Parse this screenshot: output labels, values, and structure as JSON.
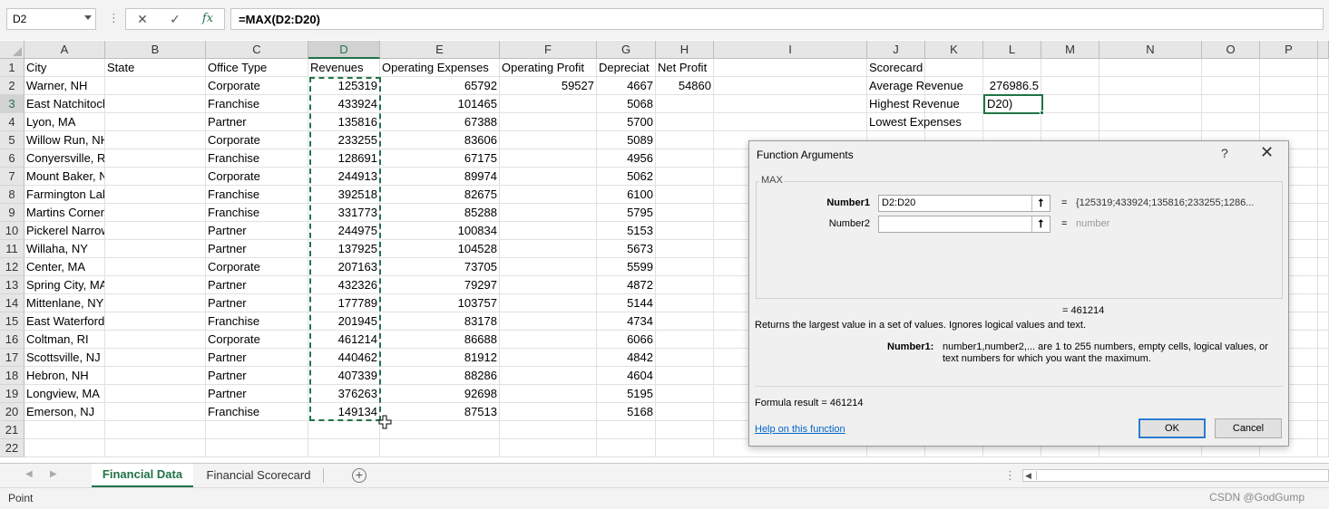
{
  "formula_bar": {
    "name_box": "D2",
    "cancel_glyph": "✕",
    "enter_glyph": "✓",
    "fx_label": "fx",
    "formula": "=MAX(D2:D20)"
  },
  "columns": [
    "A",
    "B",
    "C",
    "D",
    "E",
    "F",
    "G",
    "H",
    "I",
    "J",
    "K",
    "L",
    "M",
    "N",
    "O",
    "P"
  ],
  "active_column": "D",
  "active_row": 3,
  "row_numbers": [
    1,
    2,
    3,
    4,
    5,
    6,
    7,
    8,
    9,
    10,
    11,
    12,
    13,
    14,
    15,
    16,
    17,
    18,
    19,
    20,
    21,
    22
  ],
  "headers": {
    "city": "City",
    "state": "State",
    "office_type": "Office Type",
    "revenues": "Revenues",
    "operating_expenses": "Operating Expenses",
    "operating_profit": "Operating Profit",
    "depreciation": "Depreciat",
    "net_profit": "Net Profit"
  },
  "rows": [
    {
      "city": "Warner, NH",
      "state": "",
      "office_type": "Corporate",
      "revenues": "125319",
      "operating_expenses": "65792",
      "operating_profit": "59527",
      "depreciation": "4667",
      "net_profit": "54860"
    },
    {
      "city": "East Natchitoches, RI",
      "state": "",
      "office_type": "Franchise",
      "revenues": "433924",
      "operating_expenses": "101465",
      "operating_profit": "",
      "depreciation": "5068",
      "net_profit": ""
    },
    {
      "city": "Lyon, MA",
      "state": "",
      "office_type": "Partner",
      "revenues": "135816",
      "operating_expenses": "67388",
      "operating_profit": "",
      "depreciation": "5700",
      "net_profit": ""
    },
    {
      "city": "Willow Run, NH",
      "state": "",
      "office_type": "Corporate",
      "revenues": "233255",
      "operating_expenses": "83606",
      "operating_profit": "",
      "depreciation": "5089",
      "net_profit": ""
    },
    {
      "city": "Conyersville, RI",
      "state": "",
      "office_type": "Franchise",
      "revenues": "128691",
      "operating_expenses": "67175",
      "operating_profit": "",
      "depreciation": "4956",
      "net_profit": ""
    },
    {
      "city": "Mount Baker, NY",
      "state": "",
      "office_type": "Corporate",
      "revenues": "244913",
      "operating_expenses": "89974",
      "operating_profit": "",
      "depreciation": "5062",
      "net_profit": ""
    },
    {
      "city": "Farmington Lake, RI",
      "state": "",
      "office_type": "Franchise",
      "revenues": "392518",
      "operating_expenses": "82675",
      "operating_profit": "",
      "depreciation": "6100",
      "net_profit": ""
    },
    {
      "city": "Martins Corner, NH",
      "state": "",
      "office_type": "Franchise",
      "revenues": "331773",
      "operating_expenses": "85288",
      "operating_profit": "",
      "depreciation": "5795",
      "net_profit": ""
    },
    {
      "city": "Pickerel Narrows, ME",
      "state": "",
      "office_type": "Partner",
      "revenues": "244975",
      "operating_expenses": "100834",
      "operating_profit": "",
      "depreciation": "5153",
      "net_profit": ""
    },
    {
      "city": "Willaha, NY",
      "state": "",
      "office_type": "Partner",
      "revenues": "137925",
      "operating_expenses": "104528",
      "operating_profit": "",
      "depreciation": "5673",
      "net_profit": ""
    },
    {
      "city": "Center, MA",
      "state": "",
      "office_type": "Corporate",
      "revenues": "207163",
      "operating_expenses": "73705",
      "operating_profit": "",
      "depreciation": "5599",
      "net_profit": ""
    },
    {
      "city": "Spring City, MA",
      "state": "",
      "office_type": "Partner",
      "revenues": "432326",
      "operating_expenses": "79297",
      "operating_profit": "",
      "depreciation": "4872",
      "net_profit": ""
    },
    {
      "city": "Mittenlane, NY",
      "state": "",
      "office_type": "Partner",
      "revenues": "177789",
      "operating_expenses": "103757",
      "operating_profit": "",
      "depreciation": "5144",
      "net_profit": ""
    },
    {
      "city": "East Waterford, ME",
      "state": "",
      "office_type": "Franchise",
      "revenues": "201945",
      "operating_expenses": "83178",
      "operating_profit": "",
      "depreciation": "4734",
      "net_profit": ""
    },
    {
      "city": "Coltman, RI",
      "state": "",
      "office_type": "Corporate",
      "revenues": "461214",
      "operating_expenses": "86688",
      "operating_profit": "",
      "depreciation": "6066",
      "net_profit": ""
    },
    {
      "city": "Scottsville, NJ",
      "state": "",
      "office_type": "Partner",
      "revenues": "440462",
      "operating_expenses": "81912",
      "operating_profit": "",
      "depreciation": "4842",
      "net_profit": ""
    },
    {
      "city": "Hebron, NH",
      "state": "",
      "office_type": "Partner",
      "revenues": "407339",
      "operating_expenses": "88286",
      "operating_profit": "",
      "depreciation": "4604",
      "net_profit": ""
    },
    {
      "city": "Longview, MA",
      "state": "",
      "office_type": "Partner",
      "revenues": "376263",
      "operating_expenses": "92698",
      "operating_profit": "",
      "depreciation": "5195",
      "net_profit": ""
    },
    {
      "city": "Emerson, NJ",
      "state": "",
      "office_type": "Franchise",
      "revenues": "149134",
      "operating_expenses": "87513",
      "operating_profit": "",
      "depreciation": "5168",
      "net_profit": ""
    }
  ],
  "scorecard": {
    "title": "Scorecard",
    "avg_label": "Average Revenue",
    "avg_value": "276986.5",
    "high_label": "Highest Revenue",
    "high_value": "D20)",
    "low_label": "Lowest Expenses"
  },
  "sheet_tabs": {
    "active": "Financial Data",
    "other": "Financial Scorecard",
    "add_glyph": "+"
  },
  "status": {
    "mode": "Point",
    "watermark": "CSDN @GodGump"
  },
  "dialog": {
    "title": "Function Arguments",
    "help_glyph": "?",
    "close_glyph": "✕",
    "function_name": "MAX",
    "arg1_label": "Number1",
    "arg1_value": "D2:D20",
    "arg1_result": "{125319;433924;135816;233255;1286...",
    "arg2_label": "Number2",
    "arg2_value": "",
    "arg2_result": "number",
    "equals": "=",
    "result_line": "=   461214",
    "description": "Returns the largest value in a set of values. Ignores logical values and text.",
    "arg_help_name": "Number1:",
    "arg_help_text": "number1,number2,... are 1 to 255 numbers, empty cells, logical values, or text numbers for which you want the maximum.",
    "formula_result": "Formula result =    461214",
    "help_link": "Help on this function",
    "ok": "OK",
    "cancel": "Cancel",
    "collapse_glyph": "⭡"
  }
}
